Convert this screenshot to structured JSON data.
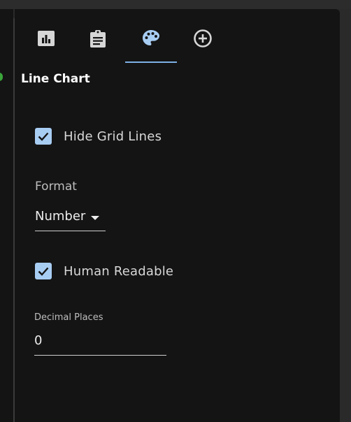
{
  "tabs": [
    {
      "name": "Chart",
      "icon": "bar-chart-icon",
      "active": false
    },
    {
      "name": "Details",
      "icon": "clipboard-icon",
      "active": false
    },
    {
      "name": "Style",
      "icon": "palette-icon",
      "active": true
    },
    {
      "name": "Add",
      "icon": "add-circle-icon",
      "active": false
    }
  ],
  "section": {
    "title": "Line Chart"
  },
  "options": {
    "hide_grid_lines": {
      "label": "Hide Grid Lines",
      "checked": true
    },
    "format": {
      "label": "Format",
      "value": "Number"
    },
    "human_readable": {
      "label": "Human Readable",
      "checked": true
    },
    "decimal_places": {
      "label": "Decimal Places",
      "value": "0"
    }
  },
  "colors": {
    "accent": "#7fb0e6",
    "checkbox": "#a8cdf3",
    "panel_bg": "#141414",
    "status_dot": "#3aa53a"
  }
}
